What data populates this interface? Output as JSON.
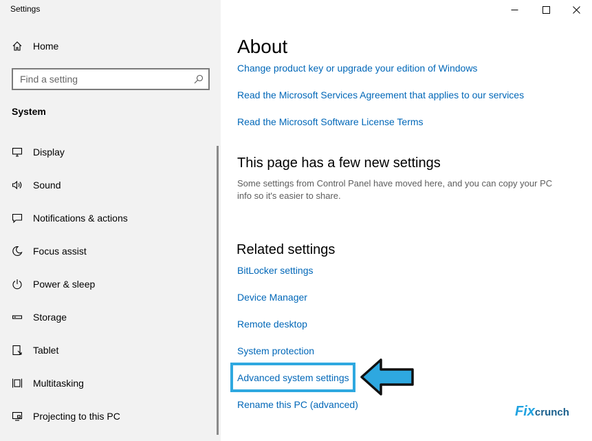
{
  "window": {
    "title": "Settings"
  },
  "sidebar": {
    "home_label": "Home",
    "search_placeholder": "Find a setting",
    "section_label": "System",
    "items": [
      {
        "label": "Display",
        "icon": "monitor-icon"
      },
      {
        "label": "Sound",
        "icon": "speaker-icon"
      },
      {
        "label": "Notifications & actions",
        "icon": "notification-icon"
      },
      {
        "label": "Focus assist",
        "icon": "moon-icon"
      },
      {
        "label": "Power & sleep",
        "icon": "power-icon"
      },
      {
        "label": "Storage",
        "icon": "storage-icon"
      },
      {
        "label": "Tablet",
        "icon": "tablet-icon"
      },
      {
        "label": "Multitasking",
        "icon": "multitasking-icon"
      },
      {
        "label": "Projecting to this PC",
        "icon": "projecting-icon"
      }
    ]
  },
  "main": {
    "title": "About",
    "links": [
      "Change product key or upgrade your edition of Windows",
      "Read the Microsoft Services Agreement that applies to our services",
      "Read the Microsoft Software License Terms"
    ],
    "new_settings": {
      "heading": "This page has a few new settings",
      "description": "Some settings from Control Panel have moved here, and you can copy your PC info so it's easier to share."
    },
    "related": {
      "heading": "Related settings",
      "links": [
        "BitLocker settings",
        "Device Manager",
        "Remote desktop",
        "System protection",
        "Advanced system settings",
        "Rename this PC (advanced)"
      ]
    }
  },
  "watermark": {
    "part1": "Fix",
    "part2": "crunch"
  },
  "colors": {
    "link": "#0067b8",
    "highlight": "#2ea8e0",
    "sidebar_bg": "#f2f2f2"
  }
}
